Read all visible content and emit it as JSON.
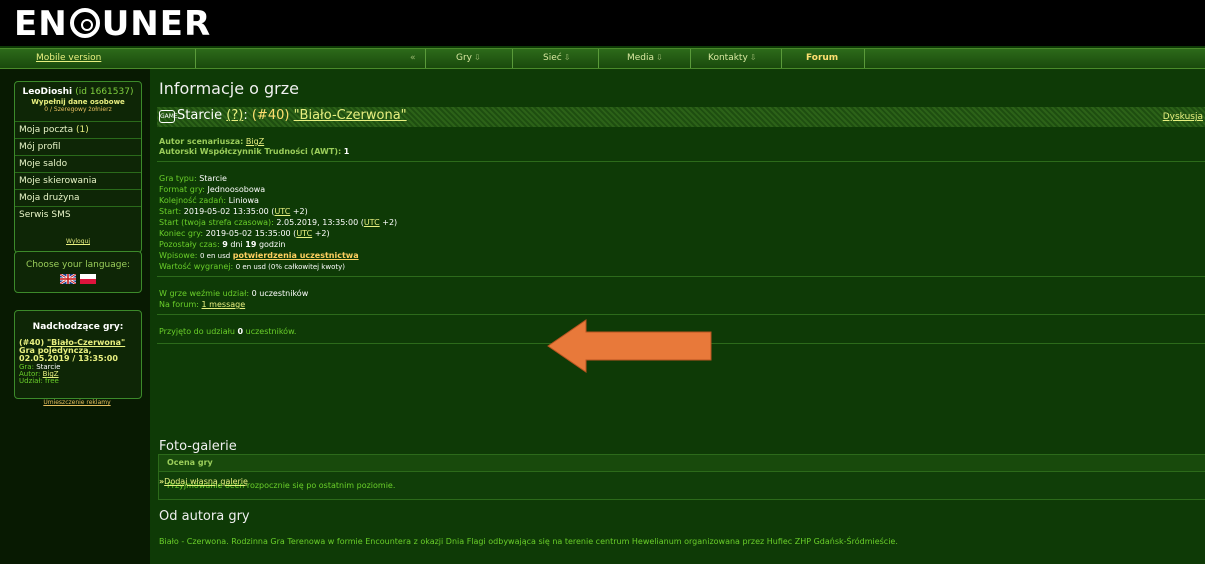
{
  "logo": {
    "text_left": "EN",
    "text_right": "UNER"
  },
  "navbar": {
    "mobile": "Mobile version",
    "collapse": "«",
    "items": [
      {
        "label": "Gry"
      },
      {
        "label": "Sieć"
      },
      {
        "label": "Media"
      },
      {
        "label": "Kontakty"
      },
      {
        "label": "Forum"
      }
    ]
  },
  "user": {
    "name": "LeoDioshi",
    "id": "(id 1661537)",
    "fill_data": "Wypełnij dane osobowe",
    "rank": "0 / Szeregowy żołnierz",
    "menu": [
      {
        "label": "Moja poczta",
        "count": "(1)"
      },
      {
        "label": "Mój profil",
        "count": ""
      },
      {
        "label": "Moje saldo",
        "count": ""
      },
      {
        "label": "Moje skierowania",
        "count": ""
      },
      {
        "label": "Moja drużyna",
        "count": ""
      },
      {
        "label": "Serwis SMS",
        "count": ""
      }
    ],
    "logout": "Wyloguj"
  },
  "language": {
    "label": "Choose your language:"
  },
  "upcoming": {
    "title": "Nadchodzące gry:",
    "num": "(#40)",
    "game_link": "\"Biało-Czerwona\"",
    "type_line": "Gra pojedyncza,",
    "datetime": "02.05.2019 / 13:35:00",
    "gra_label": "Gra:",
    "gra_value": "Starcie",
    "autor_label": "Autor:",
    "autor_value": "BigZ",
    "udzial": "Udział: free"
  },
  "ads": "Umieszczenie reklamy",
  "page": {
    "title": "Informacje o grze",
    "game": {
      "icon": "GAME",
      "prefix": "Starcie",
      "q": "(?)",
      "colon": ":",
      "num": "(#40)",
      "name": "\"Biało-Czerwona\"",
      "discussion": "Dyskusja"
    },
    "author_label": "Autor scenariusza:",
    "author_value": "BigZ",
    "awt_label": "Autorski Współczynnik Trudności (AWT):",
    "awt_value": "1",
    "details": {
      "type_label": "Gra typu:",
      "type_value": "Starcie",
      "format_label": "Format gry:",
      "format_value": "Jednoosobowa",
      "order_label": "Kolejność zadań:",
      "order_value": "Liniowa",
      "start_label": "Start:",
      "start_value": "2019-05-02 13:35:00 (",
      "utc": "UTC",
      "start_tz": "+2)",
      "start_local_label": "Start (twoja strefa czasowa):",
      "start_local_value": "2.05.2019, 13:35:00 (",
      "start_local_tz": "+2)",
      "end_label": "Koniec gry:",
      "end_value": "2019-05-02 15:35:00 (",
      "end_tz": "+2)",
      "remaining_label": "Pozostały czas:",
      "remaining_d": "9",
      "remaining_dtxt": "dni",
      "remaining_h": "19",
      "remaining_htxt": "godzin",
      "fee_label": "Wpisowe:",
      "fee_value": "0 en usd",
      "fee_link": "potwierdzenia uczestnictwa",
      "prize_label": "Wartość wygranej:",
      "prize_value": "0 en usd (0% całkowitej kwoty)"
    },
    "participants_label": "W grze weźmie udział:",
    "participants_value": "0",
    "participants_unit": "uczestników",
    "forum_label": "Na forum:",
    "forum_value": "1 message",
    "accepted_pre": "Przyjęto do udziału",
    "accepted_num": "0",
    "accepted_post": "uczestników.",
    "rating_title": "Ocena gry",
    "rating_text": "Przyjmowanie ocen rozpocznie się po ostatnim poziomie.",
    "gallery_title": "Foto-galerie",
    "gallery_link": "Dodaj własną galerię",
    "gallery_arrows": "»",
    "author_section_title": "Od autora gry",
    "author_text": "Biało - Czerwona. Rodzinna Gra Terenowa w formie Encountera z okazji Dnia Flagi odbywająca się na terenie centrum Hewelianum organizowana przez Hufiec ZHP Gdańsk-Śródmieście."
  },
  "colors": {
    "accent": "#6acf2a",
    "link": "#e8f080",
    "arrow": "#e8793a",
    "bg": "#0e3a06"
  }
}
